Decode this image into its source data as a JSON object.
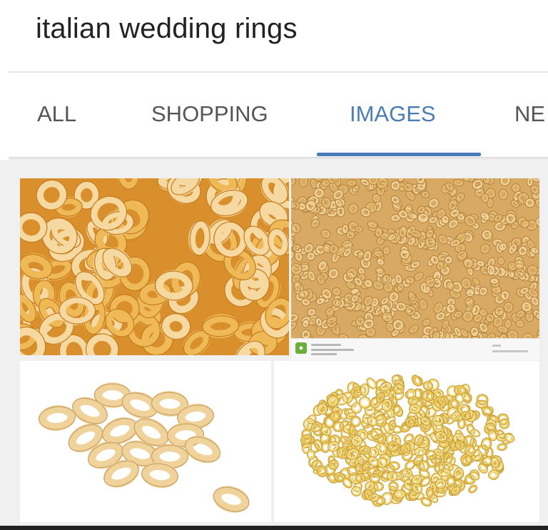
{
  "search": {
    "query": "italian wedding rings"
  },
  "tabs": [
    {
      "label": "ALL",
      "active": false
    },
    {
      "label": "SHOPPING",
      "active": false
    },
    {
      "label": "IMAGES",
      "active": true
    },
    {
      "label": "NE",
      "active": false
    }
  ],
  "colors": {
    "active_tab": "#4a7db5",
    "inactive_tab": "#555555",
    "pasta_light": "#f6d9a0",
    "pasta_mid": "#efb957",
    "pasta_dark": "#d9902c"
  },
  "results": [
    {
      "name": "pasta-rings-closeup"
    },
    {
      "name": "pasta-rings-pile-dense"
    },
    {
      "name": "pasta-rings-scattered-white"
    },
    {
      "name": "pasta-rings-mound-white"
    }
  ]
}
